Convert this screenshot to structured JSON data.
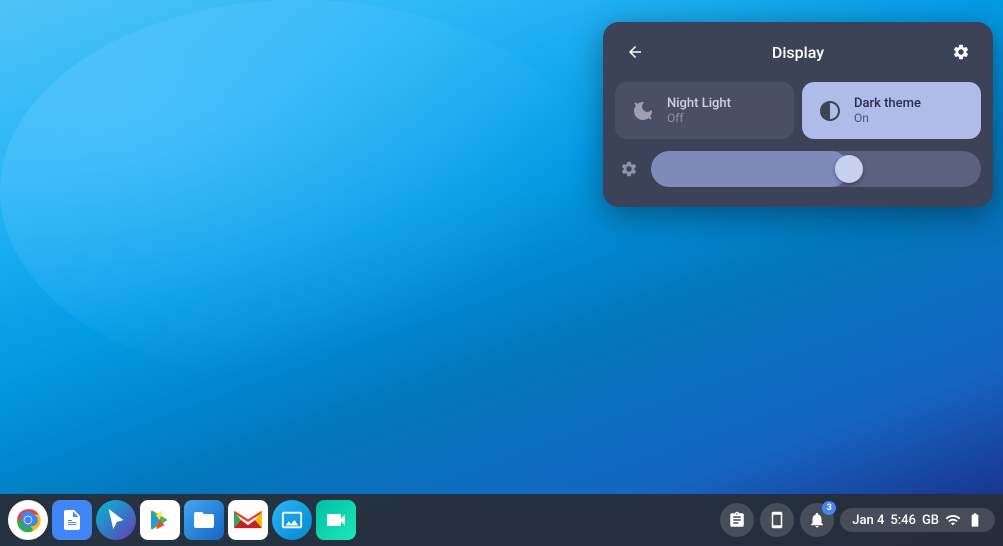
{
  "desktop": {
    "background_description": "Blue gradient ChromeOS wallpaper"
  },
  "panel": {
    "title": "Display",
    "back_button_label": "←",
    "settings_icon_label": "⚙",
    "tiles": [
      {
        "id": "night-light",
        "label": "Night Light",
        "sublabel": "Off",
        "active": false
      },
      {
        "id": "dark-theme",
        "label": "Dark theme",
        "sublabel": "On",
        "active": true
      }
    ],
    "brightness_slider": {
      "value": 60,
      "icon_label": "⚙"
    }
  },
  "taskbar": {
    "apps": [
      {
        "id": "chrome",
        "label": "Chrome"
      },
      {
        "id": "docs",
        "label": "Google Docs"
      },
      {
        "id": "cursor",
        "label": "Cursor"
      },
      {
        "id": "play",
        "label": "Play Store"
      },
      {
        "id": "files",
        "label": "Files"
      },
      {
        "id": "gmail",
        "label": "Gmail"
      },
      {
        "id": "photos",
        "label": "Photos"
      },
      {
        "id": "meet",
        "label": "Google Meet"
      }
    ],
    "system_tray": {
      "clipboard_icon": "⧉",
      "phone_icon": "📱",
      "cast_icon": "⊙",
      "notification_count": "3",
      "date": "Jan 4",
      "time": "5:46",
      "storage": "GB",
      "wifi_icon": "▾",
      "battery_icon": "🔋"
    }
  }
}
